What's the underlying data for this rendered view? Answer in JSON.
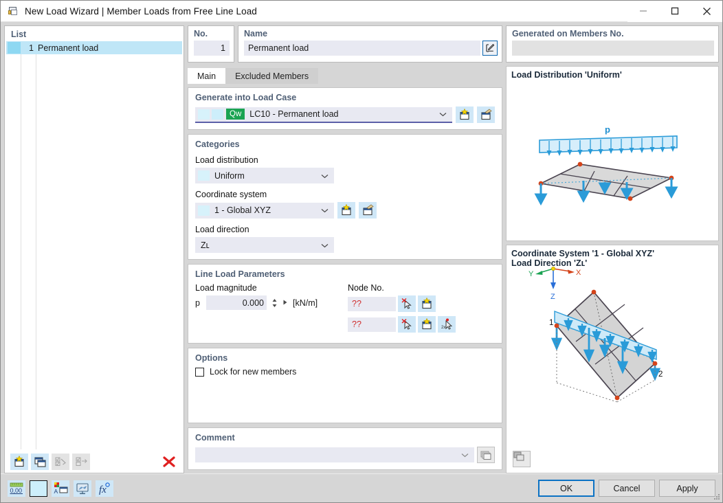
{
  "titlebar": {
    "title": "New Load Wizard | Member Loads from Free Line Load",
    "minimize": "–",
    "maximize": "□",
    "close": "✕"
  },
  "list_pane": {
    "header": "List",
    "rows": [
      {
        "number": "1",
        "name": "Permanent load"
      }
    ]
  },
  "no_panel": {
    "label": "No.",
    "value": "1"
  },
  "name_panel": {
    "label": "Name",
    "value": "Permanent load"
  },
  "generated_panel": {
    "label": "Generated on Members No.",
    "value": ""
  },
  "tabs": [
    {
      "label": "Main",
      "active": true
    },
    {
      "label": "Excluded Members",
      "active": false
    }
  ],
  "generate_into_load_case": {
    "title": "Generate into Load Case",
    "badge": "Qw",
    "value": "LC10 - Permanent load"
  },
  "categories": {
    "title": "Categories",
    "load_distribution": {
      "label": "Load distribution",
      "value": "Uniform"
    },
    "coordinate_system": {
      "label": "Coordinate system",
      "value": "1 - Global XYZ"
    },
    "load_direction": {
      "label": "Load direction",
      "value": "Zʟ"
    }
  },
  "line_load_parameters": {
    "title": "Line Load Parameters",
    "load_magnitude_label": "Load magnitude",
    "symbol": "p",
    "value": "0.000",
    "unit": "[kN/m]",
    "node_no_label": "Node No.",
    "node_1": "??",
    "node_2": "??"
  },
  "options": {
    "title": "Options",
    "lock_label": "Lock for new members",
    "lock_checked": false
  },
  "comment": {
    "title": "Comment",
    "value": ""
  },
  "viz_top": {
    "title": "Load Distribution 'Uniform'",
    "load_symbol": "p"
  },
  "viz_bottom": {
    "title_line1": "Coordinate System '1 - Global XYZ'",
    "title_line2": "Load Direction 'Zʟ'",
    "axis_x": "X",
    "axis_y": "Y",
    "axis_z": "Z",
    "node_label_1": "1",
    "node_label_2": "2"
  },
  "bottom_buttons": {
    "ok": "OK",
    "cancel": "Cancel",
    "apply": "Apply"
  },
  "status_icons": {
    "decimals": "0,00"
  },
  "colors": {
    "accent_blue": "#0b72c4",
    "load_case_green": "#1aa352",
    "field_bg": "#e8e9f2",
    "selection": "#bfe6f7",
    "group_title": "#4f5f75",
    "arrow_blue": "#1f8fd0",
    "node_red": "#d4441a",
    "error_red": "#d03030"
  }
}
